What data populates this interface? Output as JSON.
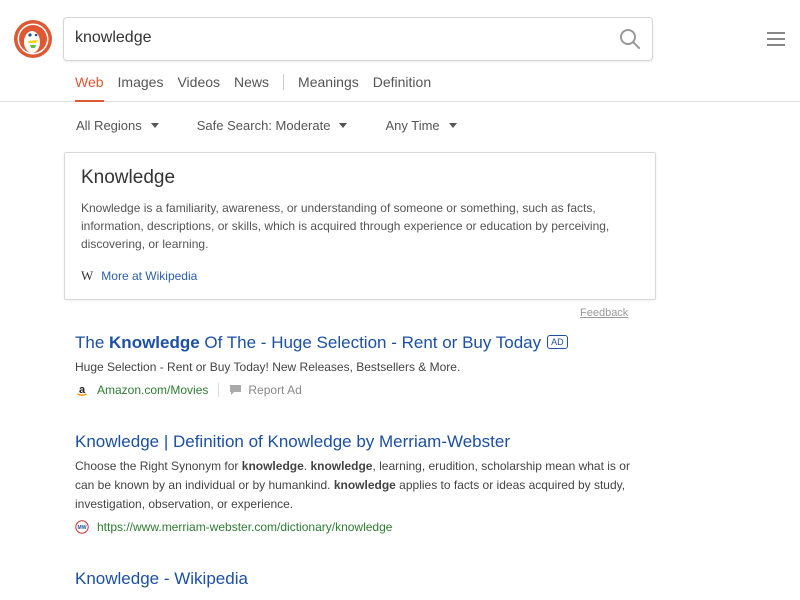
{
  "search": {
    "query": "knowledge"
  },
  "tabs": [
    {
      "label": "Web"
    },
    {
      "label": "Images"
    },
    {
      "label": "Videos"
    },
    {
      "label": "News"
    },
    {
      "label": "Meanings"
    },
    {
      "label": "Definition"
    }
  ],
  "filters": [
    {
      "label": "All Regions"
    },
    {
      "label": "Safe Search: Moderate"
    },
    {
      "label": "Any Time"
    }
  ],
  "infobox": {
    "title": "Knowledge",
    "abstract": "Knowledge is a familiarity, awareness, or understanding of someone or something, such as facts, information, descriptions, or skills, which is acquired through experience or education by perceiving, discovering, or learning.",
    "more_link": "More at Wikipedia",
    "feedback": "Feedback"
  },
  "results": [
    {
      "title_pre": "The ",
      "title_bold": "Knowledge",
      "title_post": " Of The - Huge Selection - Rent or Buy Today",
      "ad_badge": "AD",
      "snippet": "Huge Selection - Rent or Buy Today! New Releases, Bestsellers & More.",
      "url": "Amazon.com/Movies",
      "report": "Report Ad"
    },
    {
      "title": "Knowledge | Definition of Knowledge by Merriam-Webster",
      "snippet_parts": [
        "Choose the Right Synonym for ",
        "knowledge",
        ". ",
        "knowledge",
        ", learning, erudition, scholarship mean what is or can be known by an individual or by humankind. ",
        "knowledge",
        " applies to facts or ideas acquired by study, investigation, observation, or experience."
      ],
      "url": "https://www.merriam-webster.com/dictionary/knowledge"
    },
    {
      "title": "Knowledge - Wikipedia"
    }
  ]
}
